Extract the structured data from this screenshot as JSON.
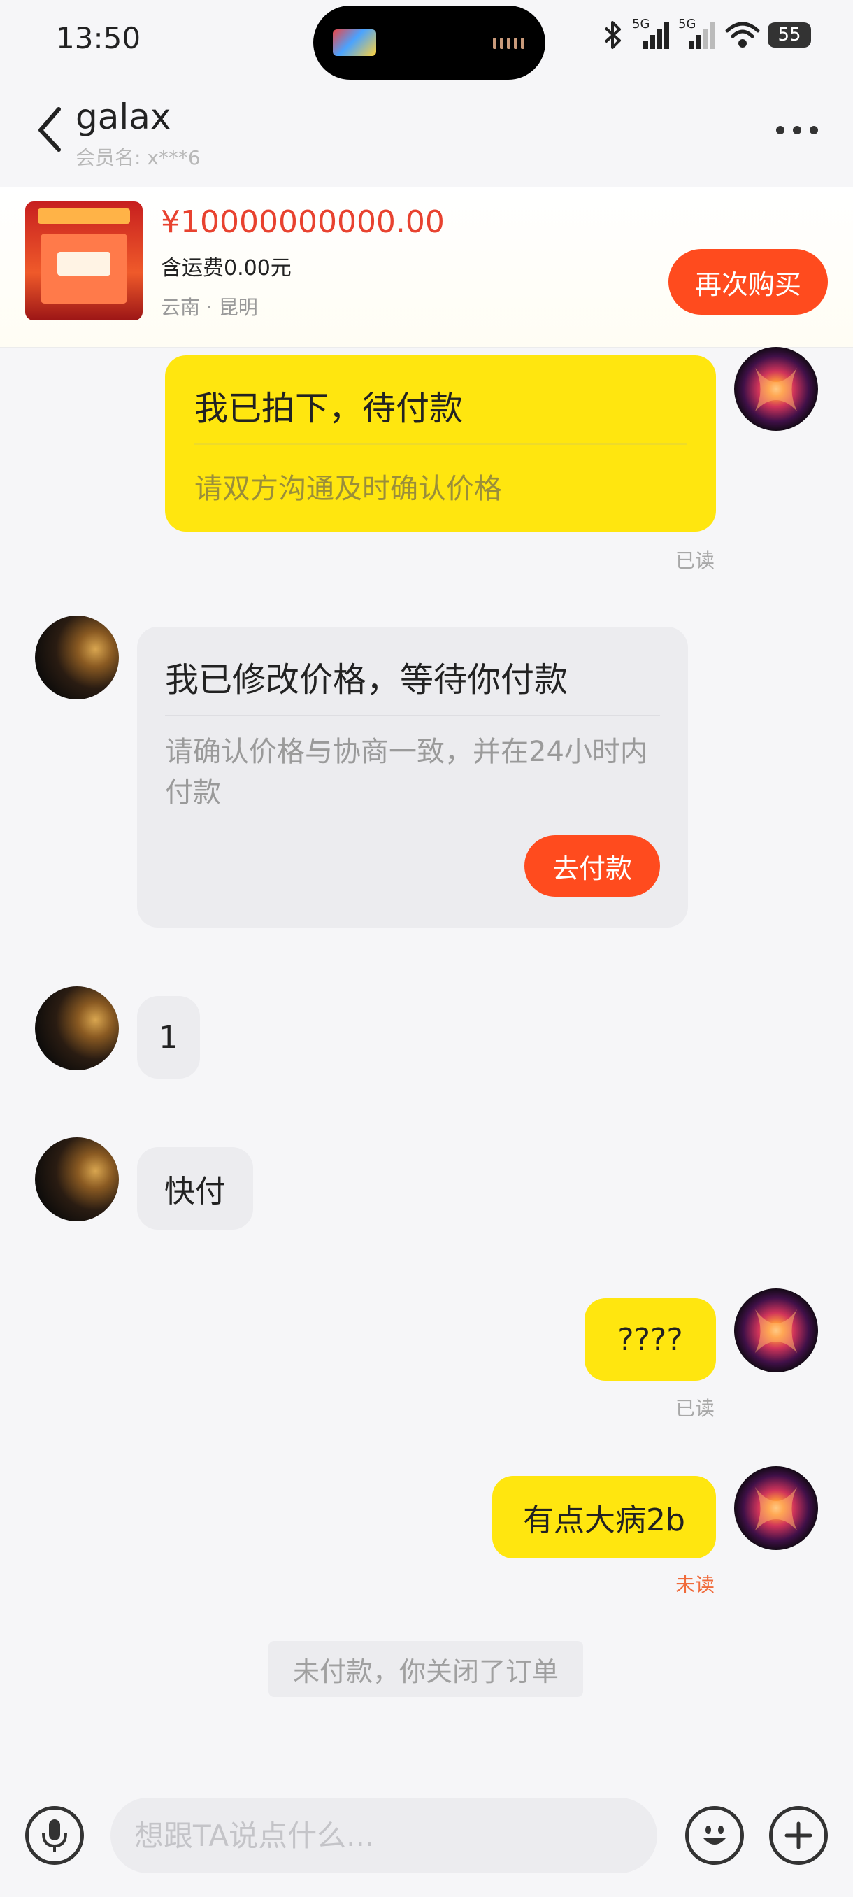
{
  "status_bar": {
    "time": "13:50",
    "network1": "5G",
    "network2": "5G",
    "battery": "55",
    "icons": [
      "bluetooth-icon",
      "signal-icon",
      "signal-icon",
      "wifi-icon",
      "battery-icon"
    ]
  },
  "header": {
    "title": "galax",
    "subtitle": "会员名: x***6",
    "back_icon": "chevron-left-icon",
    "more_icon": "more-icon"
  },
  "product": {
    "price": "¥10000000000.00",
    "shipping": "含运费0.00元",
    "location": "云南 · 昆明",
    "buy_again_label": "再次购买"
  },
  "messages": [
    {
      "from": "me",
      "type": "card",
      "title": "我已拍下，待付款",
      "subtitle": "请双方沟通及时确认价格",
      "status": "已读"
    },
    {
      "from": "other",
      "type": "card",
      "title": "我已修改价格，等待你付款",
      "subtitle": "请确认价格与协商一致，并在24小时内付款",
      "button": "去付款"
    },
    {
      "from": "other",
      "type": "text",
      "text": "1"
    },
    {
      "from": "other",
      "type": "text",
      "text": "快付"
    },
    {
      "from": "me",
      "type": "text",
      "text": "????",
      "status": "已读"
    },
    {
      "from": "me",
      "type": "text",
      "text": "有点大病2b",
      "status": "未读"
    }
  ],
  "system_notice": "未付款，你关闭了订单",
  "input_bar": {
    "placeholder": "想跟TA说点什么...",
    "icons": [
      "microphone-icon",
      "emoji-icon",
      "plus-icon"
    ]
  },
  "colors": {
    "accent": "#ff4b1e",
    "price": "#e8422f",
    "my_bubble": "#ffe60f",
    "other_bubble": "#ececef",
    "unread": "#f06a3a"
  }
}
